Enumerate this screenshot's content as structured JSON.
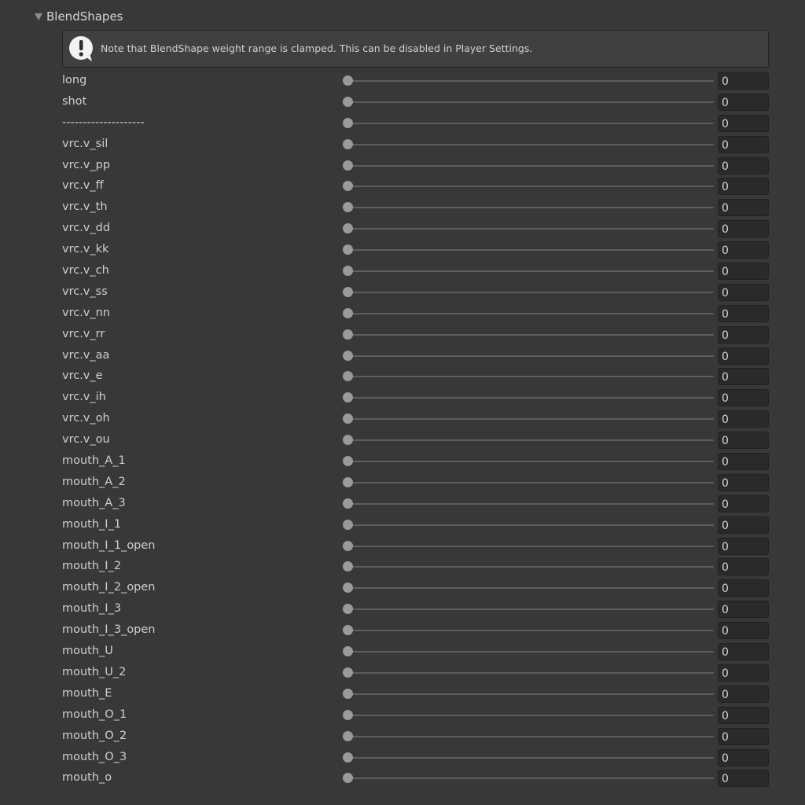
{
  "header": {
    "title": "BlendShapes",
    "collapsed": false
  },
  "helpbox": {
    "icon": "warning-icon",
    "text": "Note that BlendShape weight range is clamped. This can be disabled in Player Settings."
  },
  "blendshapes": [
    {
      "name": "long",
      "value": "0"
    },
    {
      "name": "shot",
      "value": "0"
    },
    {
      "name": "--------------------",
      "value": "0"
    },
    {
      "name": "vrc.v_sil",
      "value": "0"
    },
    {
      "name": "vrc.v_pp",
      "value": "0"
    },
    {
      "name": "vrc.v_ff",
      "value": "0"
    },
    {
      "name": "vrc.v_th",
      "value": "0"
    },
    {
      "name": "vrc.v_dd",
      "value": "0"
    },
    {
      "name": "vrc.v_kk",
      "value": "0"
    },
    {
      "name": "vrc.v_ch",
      "value": "0"
    },
    {
      "name": "vrc.v_ss",
      "value": "0"
    },
    {
      "name": "vrc.v_nn",
      "value": "0"
    },
    {
      "name": "vrc.v_rr",
      "value": "0"
    },
    {
      "name": "vrc.v_aa",
      "value": "0"
    },
    {
      "name": "vrc.v_e",
      "value": "0"
    },
    {
      "name": "vrc.v_ih",
      "value": "0"
    },
    {
      "name": "vrc.v_oh",
      "value": "0"
    },
    {
      "name": "vrc.v_ou",
      "value": "0"
    },
    {
      "name": "mouth_A_1",
      "value": "0"
    },
    {
      "name": "mouth_A_2",
      "value": "0"
    },
    {
      "name": "mouth_A_3",
      "value": "0"
    },
    {
      "name": "mouth_I_1",
      "value": "0"
    },
    {
      "name": "mouth_I_1_open",
      "value": "0"
    },
    {
      "name": "mouth_I_2",
      "value": "0"
    },
    {
      "name": "mouth_I_2_open",
      "value": "0"
    },
    {
      "name": "mouth_I_3",
      "value": "0"
    },
    {
      "name": "mouth_I_3_open",
      "value": "0"
    },
    {
      "name": "mouth_U",
      "value": "0"
    },
    {
      "name": "mouth_U_2",
      "value": "0"
    },
    {
      "name": "mouth_E",
      "value": "0"
    },
    {
      "name": "mouth_O_1",
      "value": "0"
    },
    {
      "name": "mouth_O_2",
      "value": "0"
    },
    {
      "name": "mouth_O_3",
      "value": "0"
    },
    {
      "name": "mouth_o",
      "value": "0"
    }
  ],
  "slider_range": [
    0,
    100
  ],
  "colors": {
    "background": "#383838",
    "text": "#d2d2d2",
    "slider_thumb": "#9a9a9a",
    "field_background": "#2a2a2a"
  }
}
